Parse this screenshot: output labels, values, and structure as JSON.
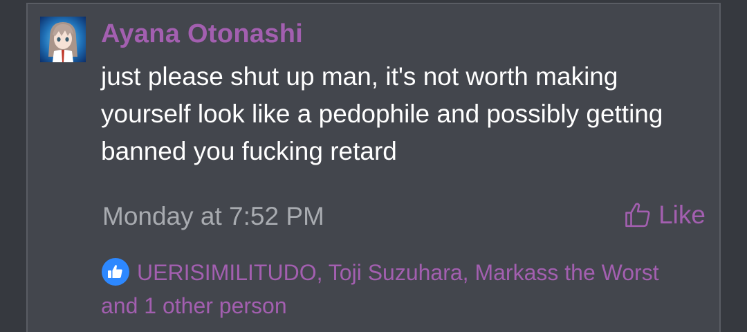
{
  "post": {
    "author": "Ayana Otonashi",
    "message": "just please shut up man, it's not worth making yourself look like a pedophile and possibly getting banned you fucking retard",
    "timestamp": "Monday at 7:52 PM",
    "like_label": "Like",
    "reactions_text": "UERISIMILITUDO, Toji Suzuhara, Markass the Worst and 1 other person"
  },
  "colors": {
    "background": "#36393f",
    "card": "#43464d",
    "accent": "#a35fb0",
    "text": "#ffffff",
    "muted": "#a8abb0",
    "reaction_badge": "#2d88ff"
  },
  "icons": {
    "avatar": "avatar-anime-character",
    "like": "thumbs-up-outline-icon",
    "reaction": "thumbs-up-badge-icon"
  }
}
